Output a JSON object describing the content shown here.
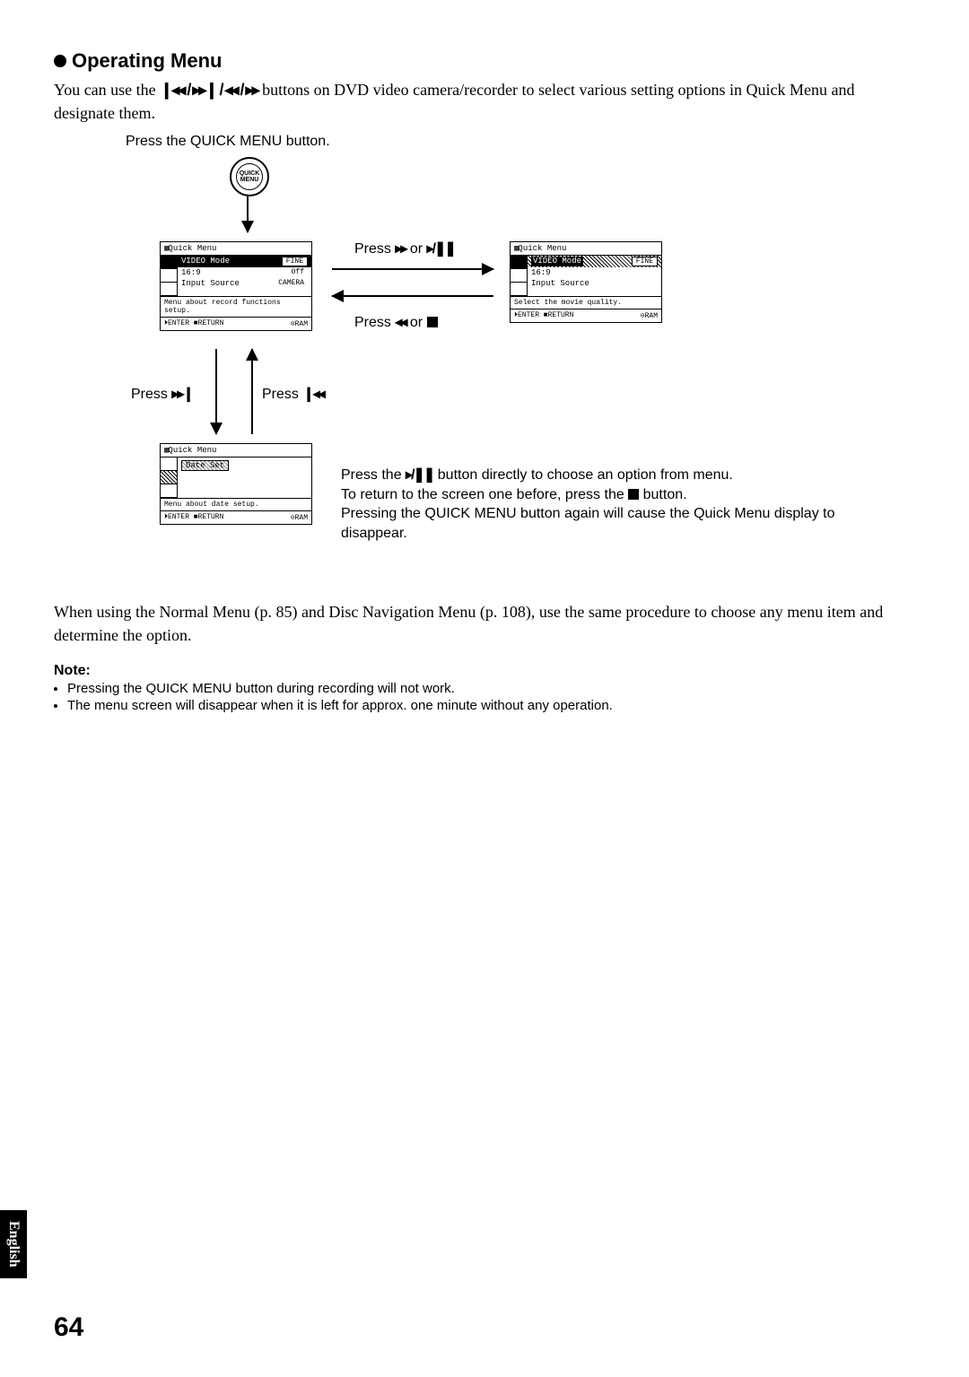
{
  "heading": "Operating Menu",
  "intro_pre": "You can use the ",
  "intro_icons": "◂◂ / ▸▸ / ◂◂ / ▸▸",
  "intro_post": " buttons on DVD video camera/recorder to select various setting options in Quick Menu and designate them.",
  "press_quick": "Press the QUICK MENU button.",
  "qmbtn_label": "QUICK\nMENU",
  "labels": {
    "press_ff_or_play": "Press ▸▸ or ▸/❚❚",
    "press_rw_or_stop": "Press ◂◂ or ■",
    "press_next": "Press ▸▸❙",
    "press_prev": "Press ❙◂◂"
  },
  "panel_a": {
    "title": "Quick Menu",
    "rows": [
      {
        "label": "VIDEO Mode",
        "value": "FINE",
        "sel": true
      },
      {
        "label": "16:9",
        "value": "Off"
      },
      {
        "label": "Input Source",
        "value": "CAMERA"
      }
    ],
    "msg": "Menu about record functions setup.",
    "footer_left": "⏵ENTER  ■RETURN",
    "footer_right": "⊙RAM"
  },
  "panel_b": {
    "title": "Quick Menu",
    "rows": [
      {
        "label": "VIDEO Mode",
        "value": "FINE",
        "sel": true,
        "hatch": true
      },
      {
        "label": "16:9",
        "value": ""
      },
      {
        "label": "Input Source",
        "value": ""
      }
    ],
    "msg": "Select the movie quality.",
    "footer_left": "⏵ENTER  ■RETURN",
    "footer_right": "⊙RAM"
  },
  "panel_c": {
    "title": "Quick Menu",
    "rows": [
      {
        "label": "Date Set",
        "value": "",
        "sel": true
      }
    ],
    "msg": "Menu about date setup.",
    "footer_left": "⏵ENTER  ■RETURN",
    "footer_right": "⊙RAM"
  },
  "explain_line1_pre": "Press the ",
  "explain_line1_sym": "▸/❚❚",
  "explain_line1_post": " button directly to choose an option from menu.",
  "explain_line2_pre": "To return to the screen one before, press the ",
  "explain_line2_post": " button.",
  "explain_line3": "Pressing the QUICK MENU button again will cause the Quick Menu display to disappear.",
  "post_text": "When using the Normal Menu (p. 85) and Disc Navigation Menu (p. 108), use the same procedure to choose any menu item and determine the option.",
  "note_heading": "Note:",
  "notes": [
    "Pressing the QUICK MENU button during recording will not work.",
    "The menu screen will disappear when it is left for approx. one minute without any operation."
  ],
  "language_tab": "English",
  "page_number": "64"
}
